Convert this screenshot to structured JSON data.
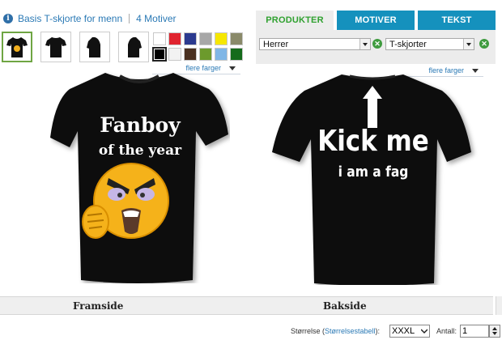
{
  "header": {
    "product_title": "Basis T-skjorte for menn",
    "motif_count": "4 Motiver"
  },
  "thumbnails": [
    {
      "name": "front-view",
      "selected": true
    },
    {
      "name": "back-view",
      "selected": false
    },
    {
      "name": "side-left",
      "selected": false
    },
    {
      "name": "side-right",
      "selected": false
    }
  ],
  "colors": [
    {
      "hex": "#ffffff",
      "selected": false
    },
    {
      "hex": "#e0242f",
      "selected": false
    },
    {
      "hex": "#2b3a8f",
      "selected": false
    },
    {
      "hex": "#a7a7a7",
      "selected": false
    },
    {
      "hex": "#f6e700",
      "selected": false
    },
    {
      "hex": "#8a8a6a",
      "selected": false
    },
    {
      "hex": "#000000",
      "selected": true
    },
    {
      "hex": "#f2f2f2",
      "selected": false
    },
    {
      "hex": "#4a3020",
      "selected": false
    },
    {
      "hex": "#6c9a2c",
      "selected": false
    },
    {
      "hex": "#7fb6e6",
      "selected": false
    },
    {
      "hex": "#156b1b",
      "selected": false
    }
  ],
  "more_colors_label": "flere farger",
  "tabs": [
    {
      "label": "PRODUKTER",
      "active": true
    },
    {
      "label": "MOTIVER",
      "active": false
    },
    {
      "label": "TEKST",
      "active": false
    }
  ],
  "filters": {
    "gender_value": "Herrer",
    "type_value": "T-skjorter"
  },
  "front": {
    "line1": "Fanboy",
    "line2": "of the year"
  },
  "back": {
    "line1": "Kick me",
    "line2": "i am a fag"
  },
  "views": {
    "front_label": "Framside",
    "back_label": "Bakside"
  },
  "order": {
    "size_label": "Størrelse (",
    "size_table_link": "Størrelsestabell",
    "size_label_end": "):",
    "size_value": "XXXL",
    "qty_label": "Antall:",
    "qty_value": "1"
  },
  "shirt_color": "#0d0d0d",
  "accent": "#1591bd"
}
